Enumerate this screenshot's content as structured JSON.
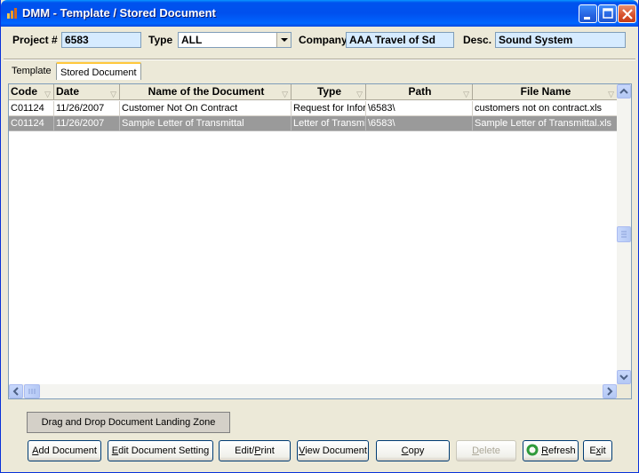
{
  "window": {
    "title": "DMM - Template / Stored Document",
    "app_icon": "dmm-app-icon"
  },
  "header": {
    "project_label": "Project #",
    "project_value": "6583",
    "type_label": "Type",
    "type_value": "ALL",
    "company_label": "Company",
    "company_value": "AAA Travel of Sd",
    "desc_label": "Desc.",
    "desc_value": "Sound System"
  },
  "tabs": [
    {
      "label": "Template",
      "active": false
    },
    {
      "label": "Stored Document",
      "active": true
    }
  ],
  "grid": {
    "columns": [
      "Code",
      "Date",
      "Name of the Document",
      "Type",
      "Path",
      "File Name"
    ],
    "rows": [
      {
        "code": "C01124",
        "date": "11/26/2007",
        "name": "Customer Not On Contract",
        "type": "Request for Inforn",
        "path": "\\6583\\",
        "file": "customers not on contract.xls",
        "selected": false
      },
      {
        "code": "C01124",
        "date": "11/26/2007",
        "name": "Sample Letter of Transmittal",
        "type": "Letter of Transmitt",
        "path": "\\6583\\",
        "file": "Sample Letter of Transmittal.xls",
        "selected": true
      }
    ]
  },
  "buttons": {
    "drop_zone": "Drag and Drop Document Landing Zone",
    "add_document_u": "A",
    "add_document_rest": "dd Document",
    "edit_setting_u": "E",
    "edit_setting_rest": "dit Document Setting",
    "edit_print_pre": "Edit/",
    "edit_print_u": "P",
    "edit_print_rest": "rint",
    "view_document_u": "V",
    "view_document_rest": "iew Document",
    "copy_u": "C",
    "copy_rest": "opy",
    "delete_u": "D",
    "delete_rest": "elete",
    "refresh_u": "R",
    "refresh_rest": "efresh",
    "exit_pre": "E",
    "exit_u": "x",
    "exit_rest": "it"
  },
  "colors": {
    "titlebar": "#0050ee",
    "field_bg": "#d6ebff",
    "selected_row": "#9a9a9a",
    "refresh_icon": "#2e9a3a"
  }
}
